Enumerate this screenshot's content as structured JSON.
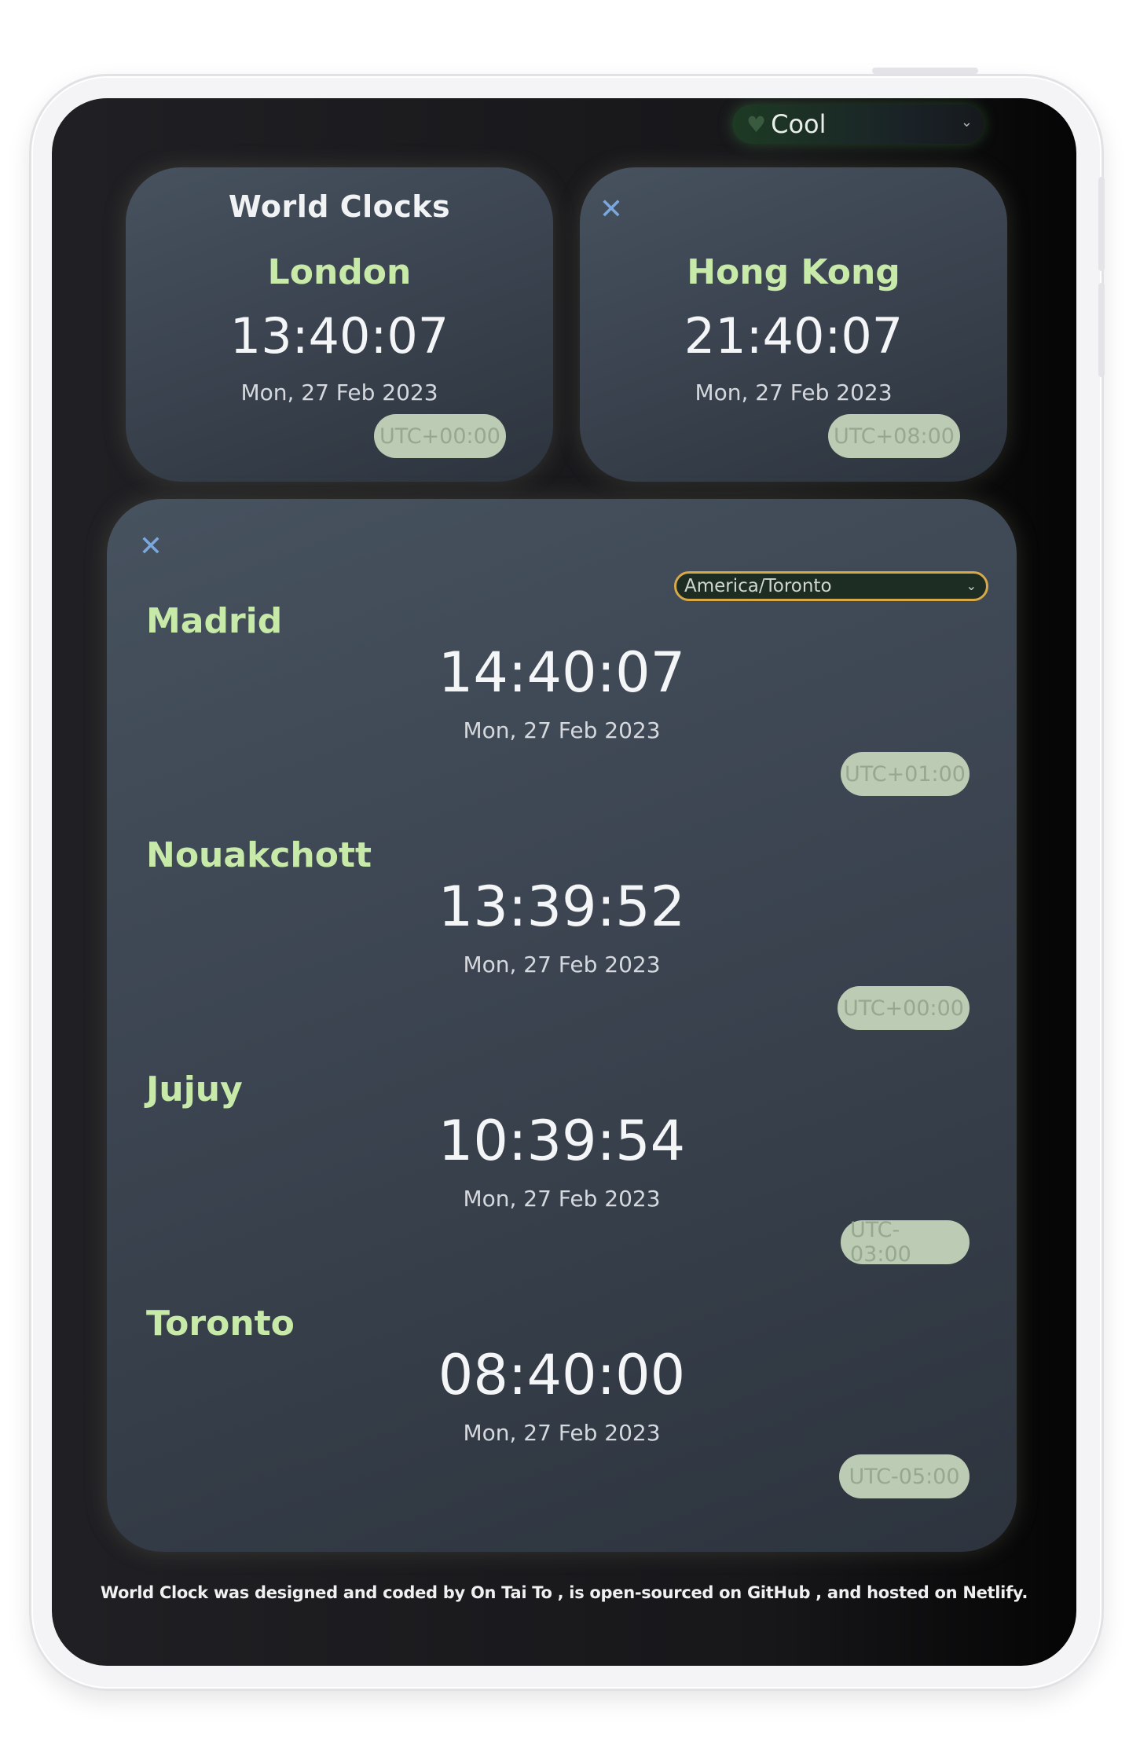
{
  "theme": {
    "selected": "Cool",
    "icon": "heart-icon"
  },
  "main_card": {
    "title": "World Clocks",
    "city": "London",
    "time": "13:40:07",
    "date": "Mon, 27 Feb 2023",
    "utc": "UTC+00:00"
  },
  "second_card": {
    "city": "Hong Kong",
    "time": "21:40:07",
    "date": "Mon, 27 Feb 2023",
    "utc": "UTC+08:00",
    "close_icon": "close-icon"
  },
  "list_card": {
    "timezone_select": "America/Toronto",
    "close_icon": "close-icon",
    "entries": [
      {
        "city": "Madrid",
        "time": "14:40:07",
        "date": "Mon, 27 Feb 2023",
        "utc": "UTC+01:00"
      },
      {
        "city": "Nouakchott",
        "time": "13:39:52",
        "date": "Mon, 27 Feb 2023",
        "utc": "UTC+00:00"
      },
      {
        "city": "Jujuy",
        "time": "10:39:54",
        "date": "Mon, 27 Feb 2023",
        "utc": "UTC-03:00"
      },
      {
        "city": "Toronto",
        "time": "08:40:00",
        "date": "Mon, 27 Feb 2023",
        "utc": "UTC-05:00"
      }
    ]
  },
  "footer": {
    "text": "World Clock was designed and coded by On Tai To , is open-sourced on GitHub , and hosted on Netlify."
  }
}
